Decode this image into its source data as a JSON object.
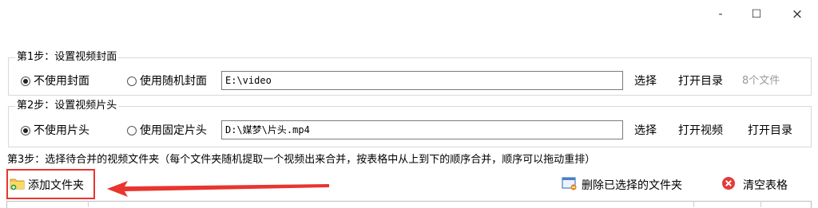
{
  "window": {
    "minimize": "-",
    "maximize": "☐",
    "close": "×"
  },
  "step1": {
    "title": "第1步：设置视频封面",
    "radio_none": "不使用封面",
    "radio_random": "使用随机封面",
    "path": "E:\\video",
    "select_btn": "选择",
    "open_dir_btn": "打开目录",
    "file_count": "8个文件"
  },
  "step2": {
    "title": "第2步：设置视频片头",
    "radio_none": "不使用片头",
    "radio_fixed": "使用固定片头",
    "path": "D:\\媒梦\\片头.mp4",
    "select_btn": "选择",
    "open_video_btn": "打开视频",
    "open_dir_btn": "打开目录"
  },
  "step3": {
    "title": "第3步：选择待合并的视频文件夹（每个文件夹随机提取一个视频出来合并，按表格中从上到下的顺序合并，顺序可以拖动重排）"
  },
  "toolbar": {
    "add_folder": "添加文件夹",
    "remove_selected": "删除已选择的文件夹",
    "clear_table": "清空表格"
  },
  "colors": {
    "highlight": "#e8352e",
    "arrow": "#e8352e"
  }
}
